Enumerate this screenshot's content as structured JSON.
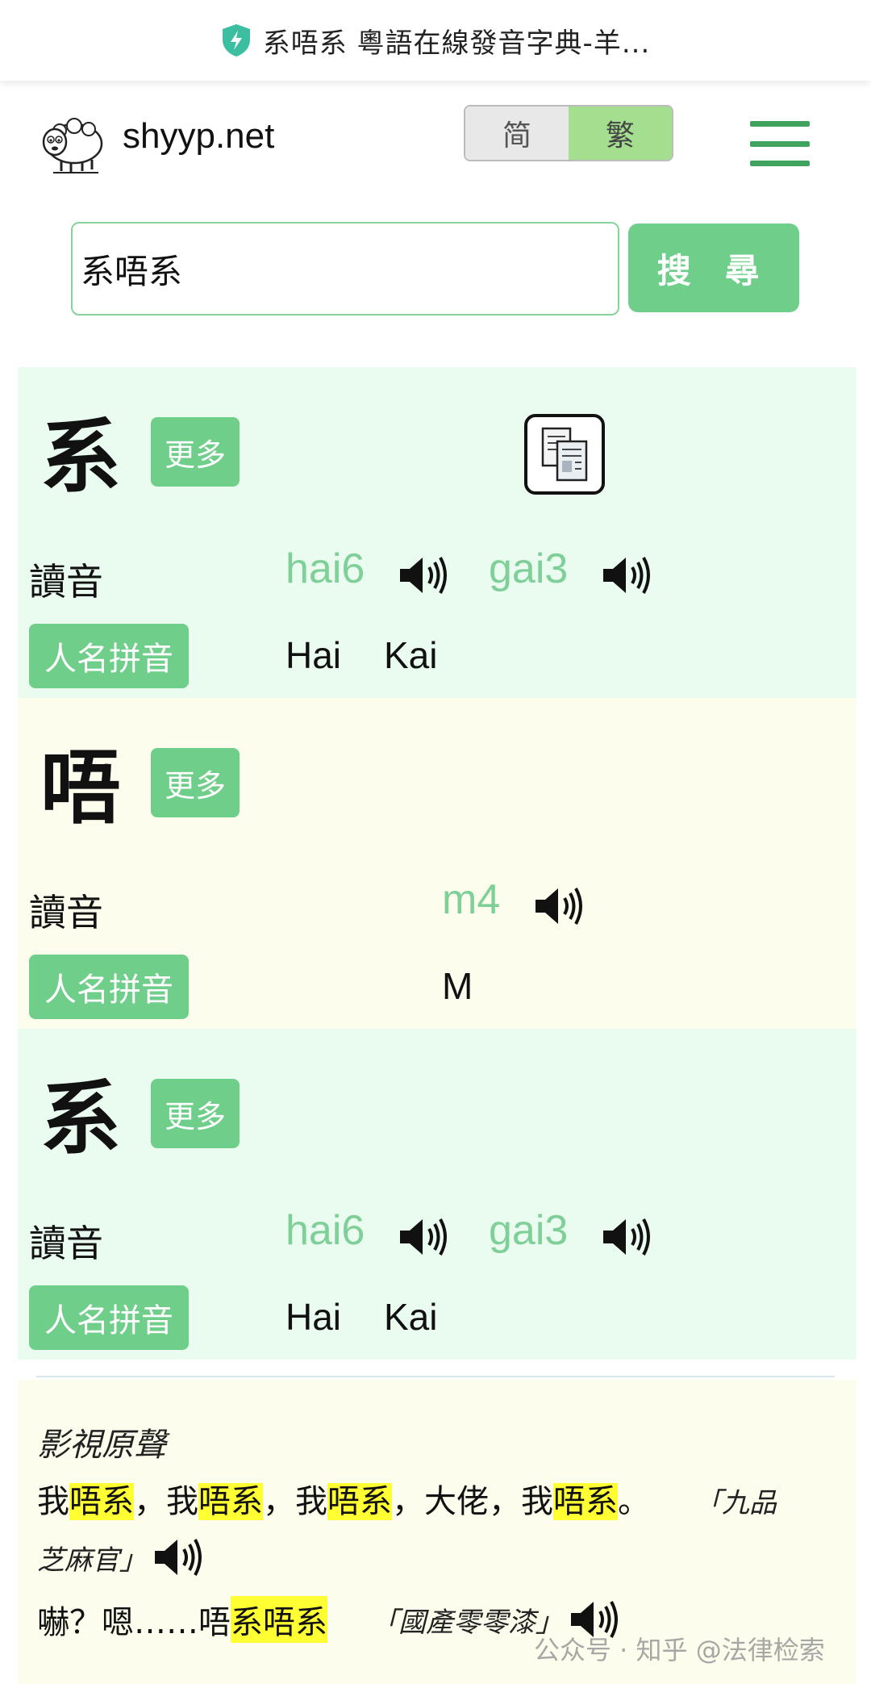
{
  "browser": {
    "title": "系唔系 粵語在線發音字典-羊..."
  },
  "header": {
    "site_name": "shyyp.net",
    "script_options": [
      "简",
      "繁"
    ],
    "active_script": "繁"
  },
  "search": {
    "value": "系唔系",
    "button_label": "搜 尋"
  },
  "labels": {
    "reading": "讀音",
    "name_romanization": "人名拼音",
    "more": "更多"
  },
  "characters": [
    {
      "char": "系",
      "readings": [
        "hai6",
        "gai3"
      ],
      "names": [
        "Hai",
        "Kai"
      ]
    },
    {
      "char": "唔",
      "readings": [
        "m4"
      ],
      "names": [
        "M"
      ]
    },
    {
      "char": "系",
      "readings": [
        "hai6",
        "gai3"
      ],
      "names": [
        "Hai",
        "Kai"
      ]
    }
  ],
  "media": {
    "title": "影視原聲",
    "q1": {
      "p1": "我",
      "h1": "唔系",
      "p2": "，我",
      "h2": "唔系",
      "p3": "，我",
      "h3": "唔系",
      "p4": "，大佬，我",
      "h4": "唔系",
      "p5": "。",
      "source_a": "「九品",
      "source_b": "芝麻官」"
    },
    "q2": {
      "p1": "嚇？嗯……唔",
      "h1": "系唔系",
      "source": "「國產零零漆」"
    }
  },
  "watermark": "公众号 · 知乎 @法律检索"
}
